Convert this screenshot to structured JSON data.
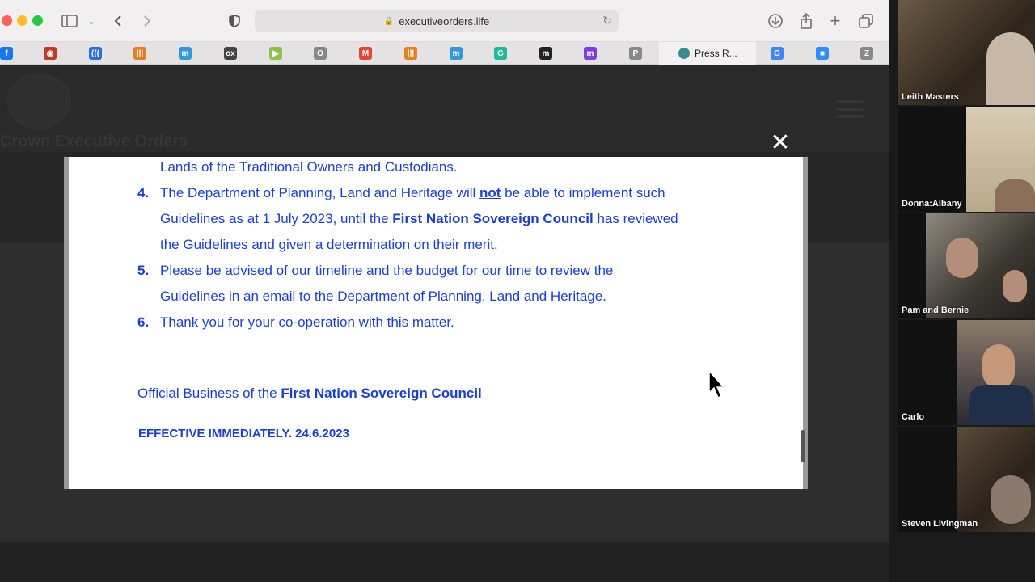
{
  "browser": {
    "url": "executiveorders.life",
    "bookmark_tab_label": "Press R...",
    "bookmarks": [
      {
        "name": "facebook-icon",
        "color": "#1877f2",
        "glyph": "f"
      },
      {
        "name": "record-icon",
        "color": "#c0392b",
        "glyph": "◉"
      },
      {
        "name": "wave-icon",
        "color": "#2a6fdb",
        "glyph": "((("
      },
      {
        "name": "bars-icon",
        "color": "#e67e22",
        "glyph": "|||"
      },
      {
        "name": "m-script-icon",
        "color": "#3498db",
        "glyph": "m"
      },
      {
        "name": "ox-icon",
        "color": "#444444",
        "glyph": "ox"
      },
      {
        "name": "play-icon",
        "color": "#8bc34a",
        "glyph": "▶"
      },
      {
        "name": "o-icon",
        "color": "#888888",
        "glyph": "O"
      },
      {
        "name": "gmail-icon",
        "color": "#ea4335",
        "glyph": "M"
      },
      {
        "name": "bars2-icon",
        "color": "#e67e22",
        "glyph": "|||"
      },
      {
        "name": "m-script2-icon",
        "color": "#3498db",
        "glyph": "m"
      },
      {
        "name": "g-icon",
        "color": "#1abc9c",
        "glyph": "G"
      },
      {
        "name": "m-black-icon",
        "color": "#222222",
        "glyph": "m"
      },
      {
        "name": "m-purple-icon",
        "color": "#7b3fe4",
        "glyph": "m"
      },
      {
        "name": "p-icon",
        "color": "#888888",
        "glyph": "P"
      }
    ],
    "bookmarks_right": [
      {
        "name": "google-icon",
        "color": "#4285f4",
        "glyph": "G"
      },
      {
        "name": "zoom-icon",
        "color": "#2d8cff",
        "glyph": "■"
      },
      {
        "name": "z-icon",
        "color": "#888888",
        "glyph": "Z"
      }
    ]
  },
  "page": {
    "title": "Crown Executive Orders"
  },
  "document": {
    "line_top": "Lands of the Traditional Owners and Custodians.",
    "item4": {
      "number": "4.",
      "a1": "The Department of Planning, Land and Heritage will ",
      "a_not": "not",
      "a2": " be able to implement such",
      "b1": "Guidelines as at 1 July 2023, until the ",
      "b_council": "First Nation Sovereign Council",
      "b2": " has reviewed",
      "c": "the Guidelines and given a determination on their merit."
    },
    "item5": {
      "number": "5.",
      "a": "Please be advised of our timeline and the budget for our time to review the",
      "b": "Guidelines in an email to the Department of Planning, Land and Heritage."
    },
    "item6": {
      "number": "6.",
      "a": "Thank you for your co-operation with this matter."
    },
    "official_prefix": "Official Business of the ",
    "official_council": "First Nation Sovereign Council",
    "effective": "EFFECTIVE IMMEDIATELY. 24.6.2023"
  },
  "participants": [
    {
      "name": "Leith Masters"
    },
    {
      "name": "Donna:Albany"
    },
    {
      "name": "Pam and Bernie"
    },
    {
      "name": "Carlo"
    },
    {
      "name": "Steven Livingman"
    }
  ]
}
